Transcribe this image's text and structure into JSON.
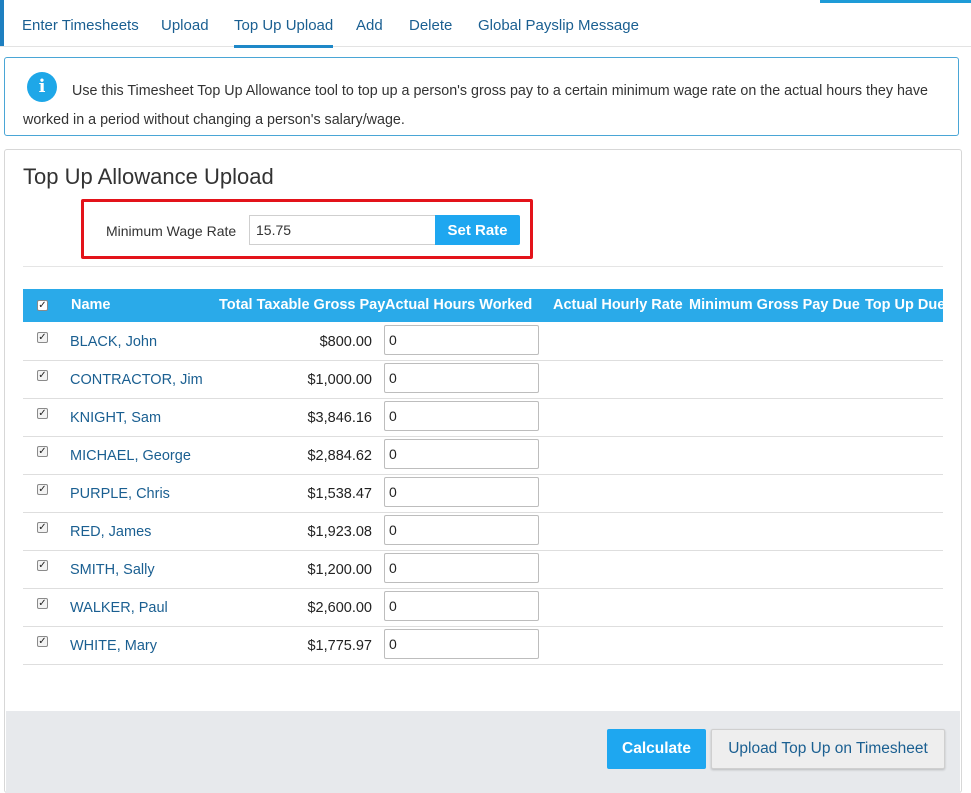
{
  "nav": {
    "tabs": [
      {
        "label": "Enter Timesheets"
      },
      {
        "label": "Upload"
      },
      {
        "label": "Top Up Upload"
      },
      {
        "label": "Add"
      },
      {
        "label": "Delete"
      },
      {
        "label": "Global Payslip Message"
      }
    ],
    "active_tab": "Top Up Upload"
  },
  "info": {
    "icon": "info-icon",
    "icon_glyph": "i",
    "text": "Use this Timesheet Top Up Allowance tool to top up a person's gross pay to a certain minimum wage rate on the actual hours they have worked in a period without changing a person's salary/wage."
  },
  "panel": {
    "title": "Top Up Allowance Upload",
    "rate": {
      "label": "Minimum Wage Rate",
      "value": "15.75",
      "button": "Set Rate"
    }
  },
  "table": {
    "headers": {
      "name": "Name",
      "gross": "Total Taxable Gross Pay",
      "hours": "Actual Hours Worked",
      "hourly": "Actual Hourly Rate",
      "min_gross": "Minimum Gross Pay Due",
      "topup": "Top Up Due"
    },
    "rows": [
      {
        "name": "BLACK, John",
        "gross": "$800.00",
        "hours": "0",
        "checked": true
      },
      {
        "name": "CONTRACTOR, Jim",
        "gross": "$1,000.00",
        "hours": "0",
        "checked": true
      },
      {
        "name": "KNIGHT, Sam",
        "gross": "$3,846.16",
        "hours": "0",
        "checked": true
      },
      {
        "name": "MICHAEL, George",
        "gross": "$2,884.62",
        "hours": "0",
        "checked": true
      },
      {
        "name": "PURPLE, Chris",
        "gross": "$1,538.47",
        "hours": "0",
        "checked": true
      },
      {
        "name": "RED, James",
        "gross": "$1,923.08",
        "hours": "0",
        "checked": true
      },
      {
        "name": "SMITH, Sally",
        "gross": "$1,200.00",
        "hours": "0",
        "checked": true
      },
      {
        "name": "WALKER, Paul",
        "gross": "$2,600.00",
        "hours": "0",
        "checked": true
      },
      {
        "name": "WHITE, Mary",
        "gross": "$1,775.97",
        "hours": "0",
        "checked": true
      }
    ]
  },
  "footer": {
    "calculate": "Calculate",
    "upload": "Upload Top Up on Timesheet"
  },
  "colors": {
    "accent": "#1ea7f0",
    "header_blue": "#2aaae9",
    "link": "#1a5f91",
    "highlight_border": "#e3131a"
  }
}
